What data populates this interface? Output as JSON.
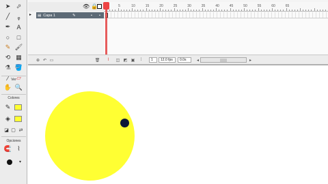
{
  "tools": {
    "view_label": "Ver",
    "colors_label": "Colores",
    "options_label": "Opciones"
  },
  "timeline": {
    "layer_name": "Capa 1",
    "ruler_ticks": [
      "5",
      "10",
      "15",
      "20",
      "25",
      "30",
      "35",
      "40",
      "45",
      "50",
      "55",
      "60",
      "65"
    ],
    "current_frame": "1",
    "fps": "12.0 fps",
    "elapsed_time": "0.0s"
  },
  "colors": {
    "fill": "#ffff33",
    "dot": "#0c1637",
    "layer_selected": "#5d6a76",
    "playhead": "#e24040"
  }
}
